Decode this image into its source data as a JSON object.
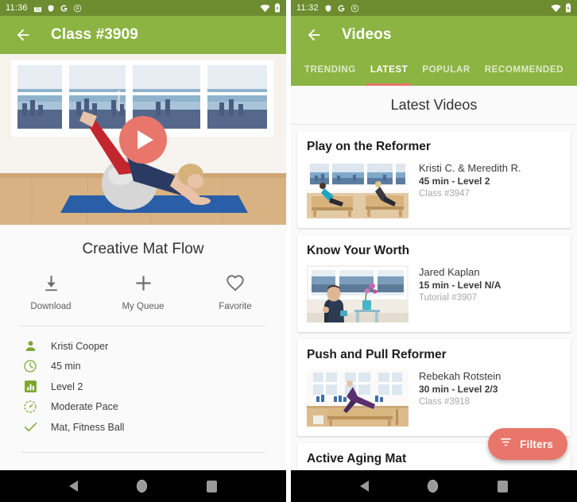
{
  "detail_screen": {
    "status_bar": {
      "time": "11:36",
      "left_icons": [
        "calendar-31-icon",
        "shield-icon",
        "google-g-icon",
        "circle-spiral-icon"
      ],
      "right_icons": [
        "wifi-icon",
        "battery-icon"
      ]
    },
    "app_bar": {
      "back_icon": "back-arrow-icon",
      "title": "Class #3909"
    },
    "hero": {
      "play_icon": "play-button-icon",
      "alt": "Woman doing pilates on fitness ball"
    },
    "title": "Creative Mat Flow",
    "actions": [
      {
        "icon": "download-icon",
        "label": "Download"
      },
      {
        "icon": "plus-icon",
        "label": "My Queue"
      },
      {
        "icon": "heart-outline-icon",
        "label": "Favorite"
      }
    ],
    "meta": [
      {
        "icon": "person-icon",
        "text": "Kristi Cooper"
      },
      {
        "icon": "clock-icon",
        "text": "45 min"
      },
      {
        "icon": "bar-chart-icon",
        "text": "Level 2"
      },
      {
        "icon": "speedometer-icon",
        "text": "Moderate Pace"
      },
      {
        "icon": "check-icon",
        "text": "Mat, Fitness Ball"
      }
    ]
  },
  "list_screen": {
    "status_bar": {
      "time": "11:32",
      "left_icons": [
        "shield-icon",
        "google-g-icon",
        "circle-spiral-icon"
      ],
      "right_icons": [
        "wifi-icon",
        "battery-icon"
      ]
    },
    "app_bar": {
      "back_icon": "back-arrow-icon",
      "title": "Videos"
    },
    "tabs": [
      {
        "label": "TRENDING",
        "active": false
      },
      {
        "label": "LATEST",
        "active": true
      },
      {
        "label": "POPULAR",
        "active": false
      },
      {
        "label": "RECOMMENDED",
        "active": false
      }
    ],
    "section_title": "Latest Videos",
    "videos": [
      {
        "title": "Play on the Reformer",
        "author": "Kristi C. & Meredith R.",
        "details": "45 min - Level 2",
        "id": "Class #3947",
        "thumb": "reformer-studio-two-people"
      },
      {
        "title": "Know Your Worth",
        "author": "Jared Kaplan",
        "details": "15 min - Level N/A",
        "id": "Tutorial #3907",
        "thumb": "man-seated-with-orchid"
      },
      {
        "title": "Push and Pull Reformer",
        "author": "Rebekah Rotstein",
        "details": "30 min - Level 2/3",
        "id": "Class #3918",
        "thumb": "woman-on-reformer-stretch"
      },
      {
        "title": "Active Aging Mat",
        "author": "",
        "details": "",
        "id": "",
        "thumb": ""
      }
    ],
    "fab": {
      "icon": "filter-icon",
      "label": "Filters"
    }
  },
  "nav_bar": {
    "back": "nav-back-icon",
    "home": "nav-home-icon",
    "recents": "nav-recents-icon"
  },
  "colors": {
    "status_bar_green": "#6d8c2f",
    "app_bar_green": "#8bb442",
    "accent_coral": "#e8766b",
    "page_background": "#fafafa",
    "card_white": "#ffffff"
  }
}
